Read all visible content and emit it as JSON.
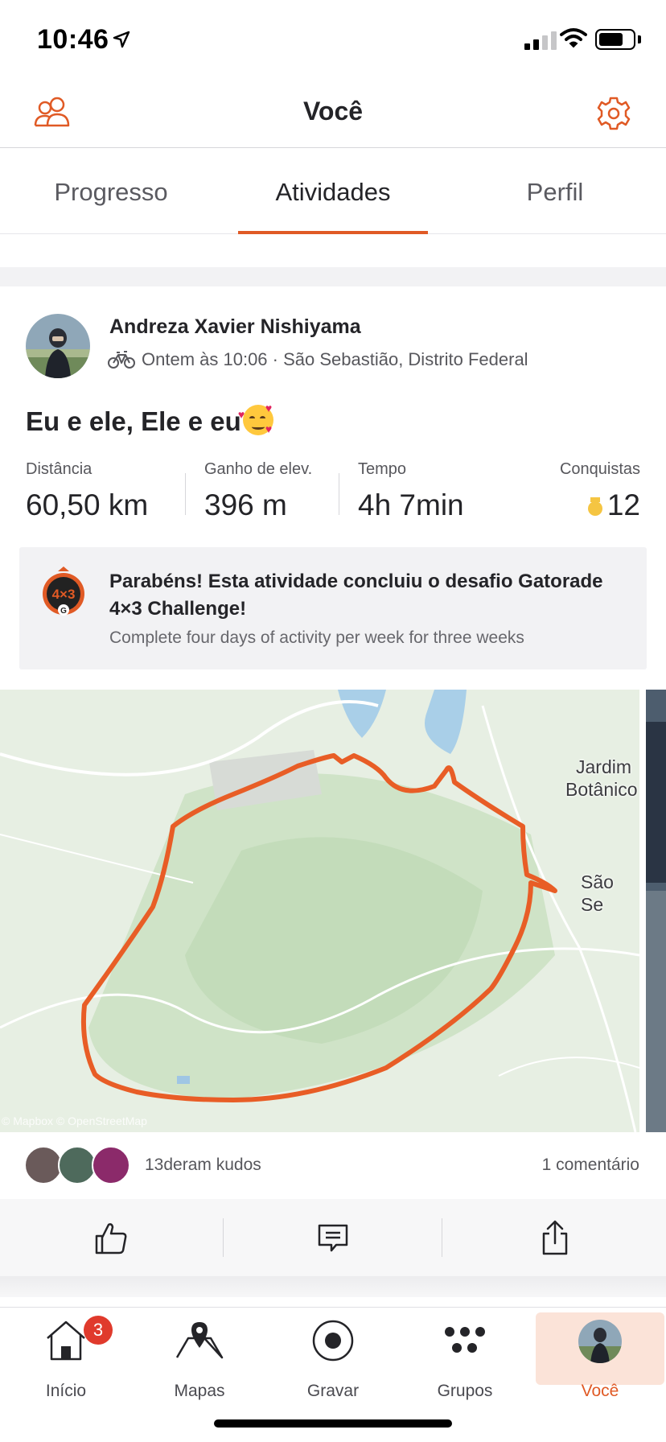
{
  "status_bar": {
    "time": "10:46"
  },
  "header": {
    "title": "Você",
    "left_icon": "friends-icon",
    "right_icon": "gear-icon"
  },
  "tabs": [
    {
      "label": "Progresso",
      "active": false
    },
    {
      "label": "Atividades",
      "active": true
    },
    {
      "label": "Perfil",
      "active": false
    }
  ],
  "activity": {
    "athlete_name": "Andreza Xavier Nishiyama",
    "sport_icon": "bike-icon",
    "meta": "Ontem às 10:06 · São Sebastião, Distrito Federal",
    "title": "Eu e ele, Ele e eu",
    "title_emoji": "smiling-face-with-hearts",
    "stats": [
      {
        "label": "Distância",
        "value": "60,50 km"
      },
      {
        "label": "Ganho de elev.",
        "value": "396 m"
      },
      {
        "label": "Tempo",
        "value": "4h 7min"
      },
      {
        "label": "Conquistas",
        "value": "12"
      }
    ],
    "challenge": {
      "badge_text": "4×3",
      "title": "Parabéns! Esta atividade concluiu o desafio Gatorade 4×3 Challenge!",
      "description": "Complete four days of activity per week for three weeks"
    },
    "map": {
      "labels": [
        "Jardim",
        "Botânico",
        "São Se"
      ],
      "attribution": "© Mapbox © OpenStreetMap",
      "route_color": "#e85d26"
    },
    "kudos": {
      "text": "13deram kudos",
      "comments": "1 comentário"
    }
  },
  "actions": [
    {
      "name": "kudos-button",
      "icon": "thumbs-up-icon"
    },
    {
      "name": "comment-button",
      "icon": "comment-icon"
    },
    {
      "name": "share-button",
      "icon": "share-icon"
    }
  ],
  "tabbar": {
    "items": [
      {
        "label": "Início",
        "icon": "home-icon",
        "badge": "3"
      },
      {
        "label": "Mapas",
        "icon": "map-icon"
      },
      {
        "label": "Gravar",
        "icon": "record-icon"
      },
      {
        "label": "Grupos",
        "icon": "groups-icon"
      },
      {
        "label": "Você",
        "icon": "avatar",
        "active": true
      }
    ]
  },
  "colors": {
    "accent": "#e05a25",
    "badge": "#e03a2c"
  }
}
